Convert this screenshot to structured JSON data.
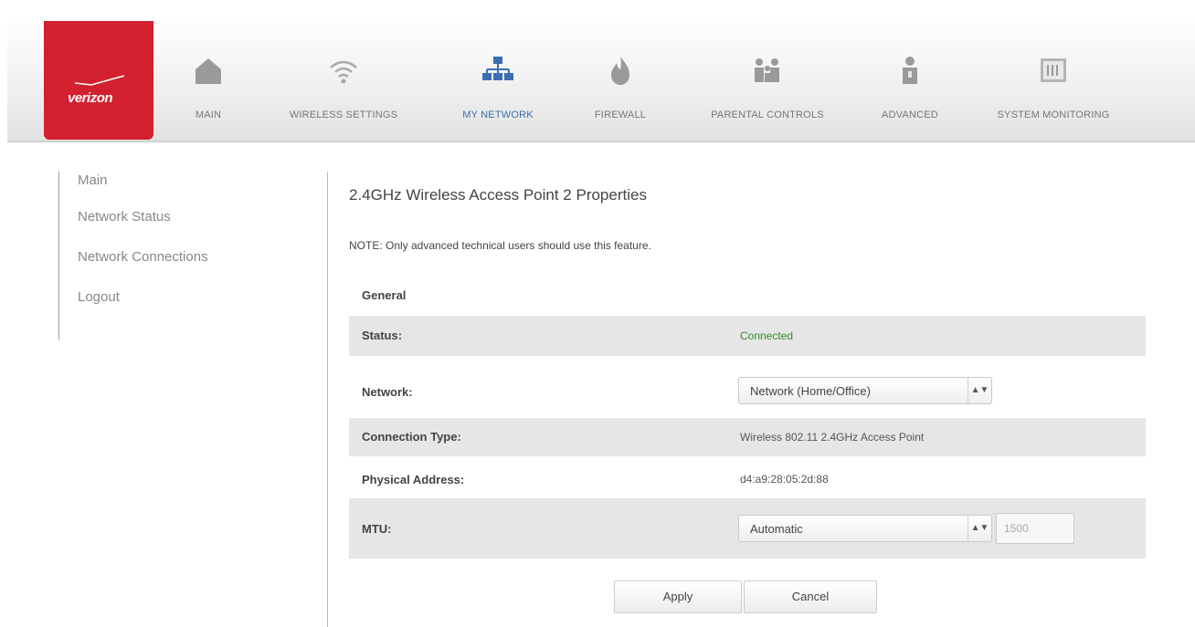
{
  "brand": {
    "logo_text": "verizon",
    "logo_color": "#d3202f"
  },
  "nav": {
    "items": [
      {
        "label": "MAIN",
        "icon": "home-icon"
      },
      {
        "label": "WIRELESS SETTINGS",
        "icon": "wifi-icon"
      },
      {
        "label": "MY NETWORK",
        "icon": "network-icon",
        "active": true
      },
      {
        "label": "FIREWALL",
        "icon": "fire-icon"
      },
      {
        "label": "PARENTAL CONTROLS",
        "icon": "family-icon"
      },
      {
        "label": "ADVANCED",
        "icon": "person-icon"
      },
      {
        "label": "SYSTEM MONITORING",
        "icon": "monitor-icon"
      }
    ],
    "active_color": "#3b6fb0"
  },
  "sidebar": {
    "items": [
      {
        "label": "Main"
      },
      {
        "label": "Network Status"
      },
      {
        "label": "Network Connections"
      },
      {
        "label": "Logout"
      }
    ]
  },
  "main": {
    "title": "2.4GHz Wireless Access Point 2 Properties",
    "note": "NOTE: Only advanced technical users should use this feature.",
    "section": "General",
    "rows": {
      "status": {
        "label": "Status:",
        "value": "Connected",
        "value_color": "#2e8b2e"
      },
      "network": {
        "label": "Network:",
        "selected": "Network (Home/Office)"
      },
      "connection_type": {
        "label": "Connection Type:",
        "value": "Wireless 802.11 2.4GHz Access Point"
      },
      "physical_address": {
        "label": "Physical Address:",
        "value": "d4:a9:28:05:2d:88"
      },
      "mtu": {
        "label": "MTU:",
        "selected": "Automatic",
        "input_placeholder": "1500"
      }
    },
    "buttons": {
      "apply": "Apply",
      "cancel": "Cancel"
    }
  }
}
